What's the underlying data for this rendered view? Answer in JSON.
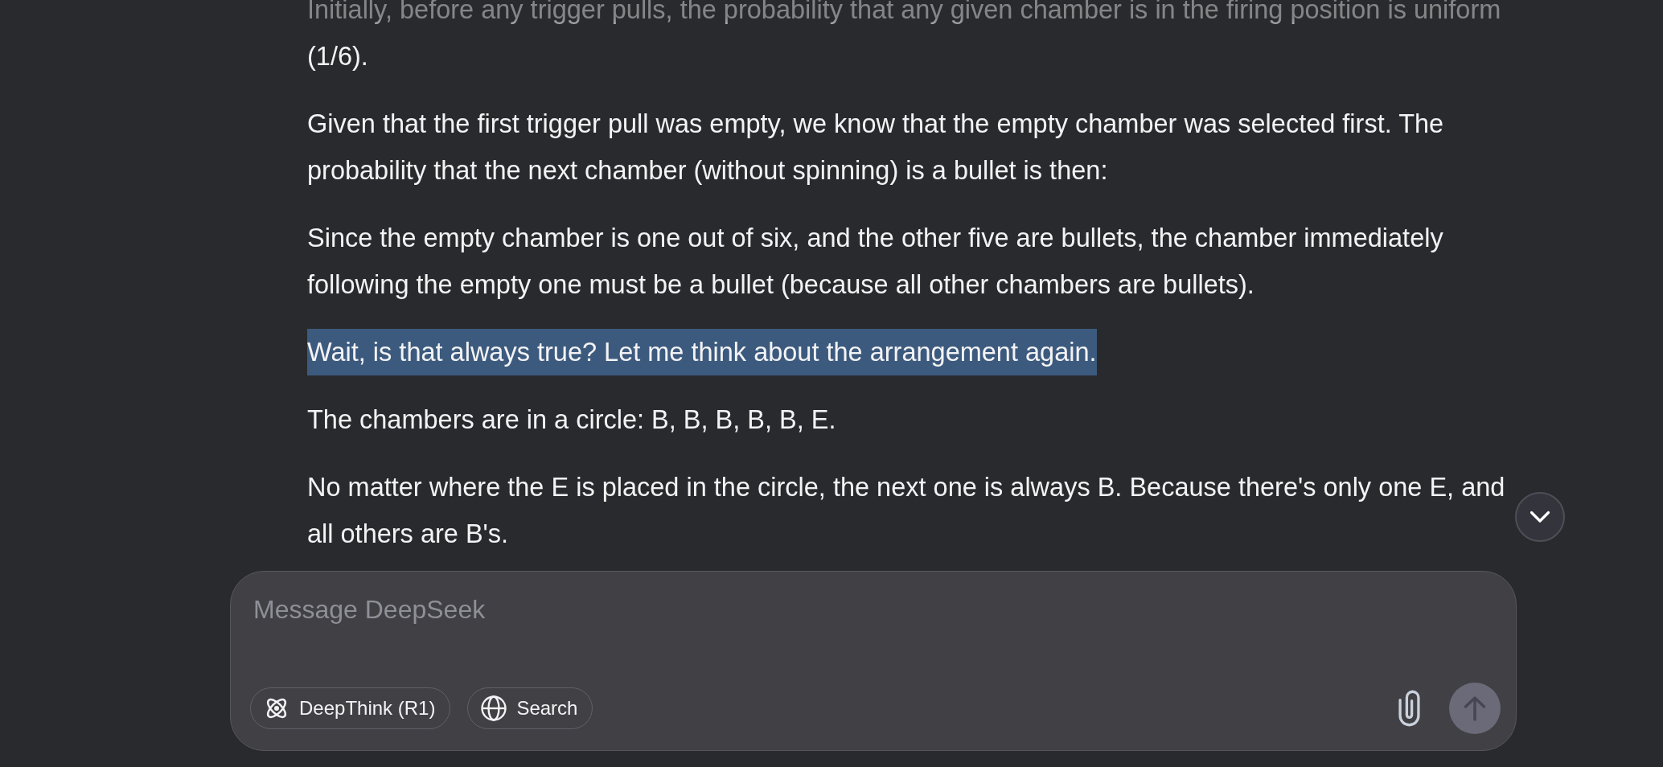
{
  "messages": {
    "paragraphs": [
      {
        "lines": [
          "Initially, before any trigger pulls, the probability that any given chamber is in the firing position is uniform",
          "(1/6)."
        ],
        "highlighted": false
      },
      {
        "lines": [
          "Given that the first trigger pull was empty, we know that the empty chamber was selected first. The",
          "probability that the next chamber (without spinning) is a bullet is then:"
        ],
        "highlighted": false
      },
      {
        "lines": [
          "Since the empty chamber is one out of six, and the other five are bullets, the chamber immediately",
          "following the empty one must be a bullet (because all other chambers are bullets)."
        ],
        "highlighted": false
      },
      {
        "lines": [
          "Wait, is that always true? Let me think about the arrangement again."
        ],
        "highlighted": true
      },
      {
        "lines": [
          "The chambers are in a circle: B, B, B, B, B, E."
        ],
        "highlighted": false
      },
      {
        "lines": [
          "No matter where the E is placed in the circle, the next one is always B. Because there's only one E, and",
          "all others are B's."
        ],
        "highlighted": false
      }
    ]
  },
  "composer": {
    "placeholder": "Message DeepSeek",
    "toggles": [
      {
        "label": "DeepThink (R1)",
        "kind": "reasoning",
        "selected": false
      },
      {
        "label": "Search",
        "kind": "search",
        "selected": false
      }
    ],
    "send_button": {
      "disabled": true
    }
  }
}
